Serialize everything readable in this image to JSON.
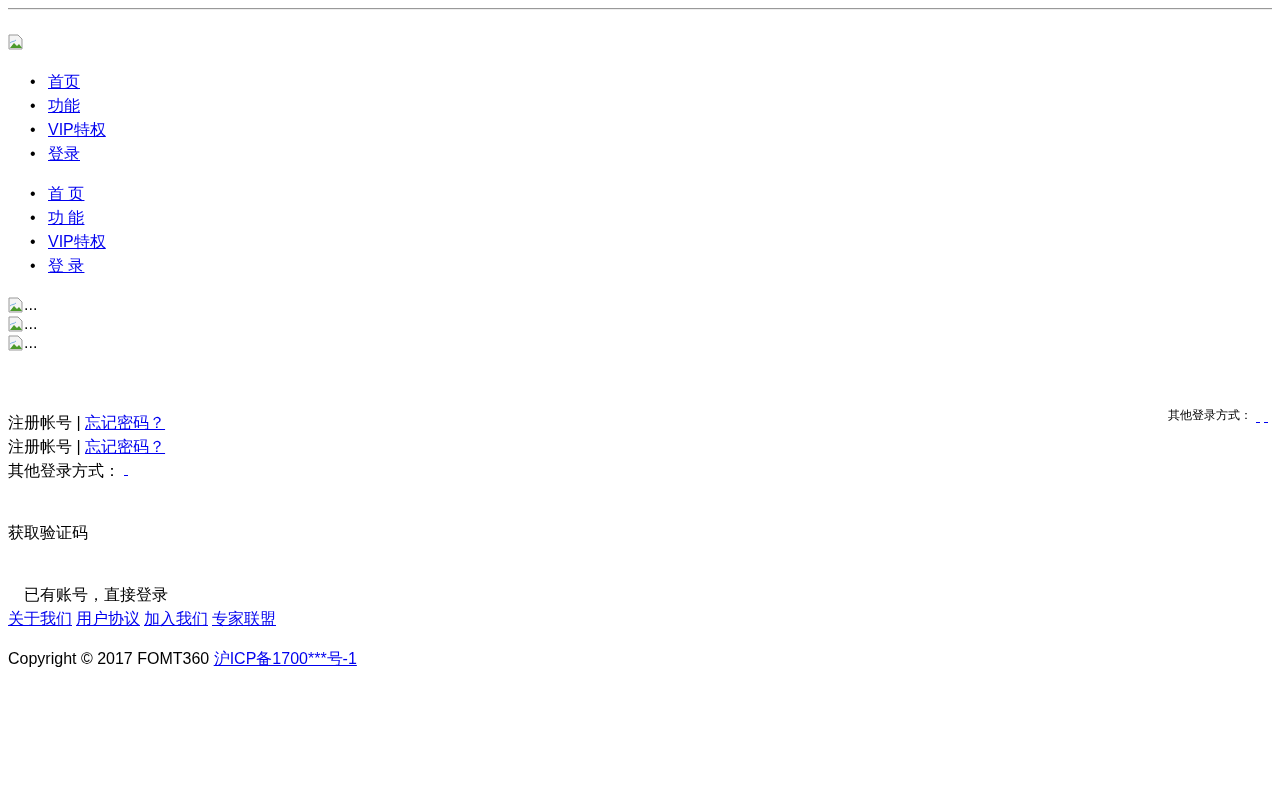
{
  "nav_menus": [
    {
      "items": [
        {
          "bullet": "•",
          "label": "首页"
        },
        {
          "bullet": "•",
          "label": "功能"
        },
        {
          "bullet": "•",
          "label": "VIP特权"
        },
        {
          "bullet": "•",
          "label": "登录"
        }
      ]
    },
    {
      "items": [
        {
          "bullet": "•",
          "label": "首 页"
        },
        {
          "bullet": "•",
          "label": "功 能"
        },
        {
          "bullet": "•",
          "label": "VIP特权"
        },
        {
          "bullet": "•",
          "label": "登 录"
        }
      ]
    }
  ],
  "slides": [
    "...",
    "...",
    "..."
  ],
  "side_login": {
    "label": "其他登录方式：",
    "links": [
      {
        "kind": "empty"
      },
      {
        "kind": "empty"
      }
    ]
  },
  "account_rows": [
    {
      "text": "注册帐号 |",
      "link": "忘记密码？"
    },
    {
      "text": "注册帐号 |",
      "link": "忘记密码？"
    }
  ],
  "other_login": {
    "label": "其他登录方式：",
    "links": [
      {
        "kind": "empty"
      }
    ]
  },
  "get_code": "获取验证码",
  "has_account": "已有账号，直接登录",
  "footer_links": [
    "关于我们",
    "用户协议",
    "加入我们",
    "专家联盟"
  ],
  "copyright": {
    "text": "Copyright © 2017 FOMT360",
    "link": "沪ICP备1700***号-1"
  }
}
